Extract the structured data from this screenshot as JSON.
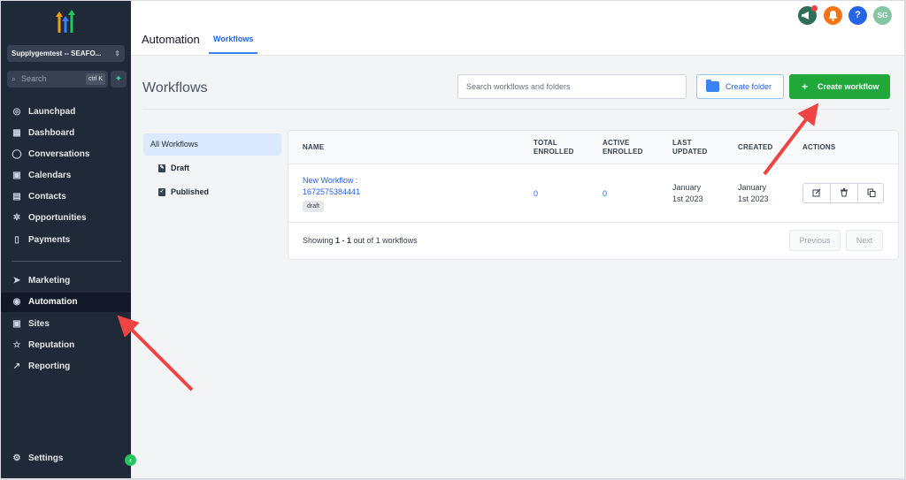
{
  "sidebar": {
    "account": "Supplygemtest -- SEAFO...",
    "search": {
      "placeholder": "Search",
      "shortcut": "ctrl K"
    },
    "items": [
      {
        "label": "Launchpad",
        "icon": "rocket-icon",
        "glyph": "◎"
      },
      {
        "label": "Dashboard",
        "icon": "grid-icon",
        "glyph": "▦"
      },
      {
        "label": "Conversations",
        "icon": "chat-icon",
        "glyph": "◯"
      },
      {
        "label": "Calendars",
        "icon": "calendar-icon",
        "glyph": "▣"
      },
      {
        "label": "Contacts",
        "icon": "contacts-icon",
        "glyph": "▤"
      },
      {
        "label": "Opportunities",
        "icon": "opportunities-icon",
        "glyph": "✲"
      },
      {
        "label": "Payments",
        "icon": "payments-icon",
        "glyph": "▯"
      },
      {
        "label": "Marketing",
        "icon": "send-icon",
        "glyph": "➤"
      },
      {
        "label": "Automation",
        "icon": "automation-icon",
        "glyph": "◉"
      },
      {
        "label": "Sites",
        "icon": "sites-icon",
        "glyph": "▣"
      },
      {
        "label": "Reputation",
        "icon": "star-icon",
        "glyph": "☆"
      },
      {
        "label": "Reporting",
        "icon": "trend-icon",
        "glyph": "↗"
      }
    ],
    "settings": "Settings"
  },
  "header": {
    "title": "Automation",
    "tab": "Workflows",
    "avatar": "SG",
    "help": "?"
  },
  "page": {
    "title": "Workflows",
    "search_placeholder": "Search workflows and folders",
    "create_folder": "Create folder",
    "create_workflow": "Create workflow"
  },
  "filters": {
    "all": "All Workflows",
    "draft": "Draft",
    "published": "Published"
  },
  "table": {
    "headers": {
      "name": "NAME",
      "total_1": "TOTAL",
      "total_2": "ENROLLED",
      "active_1": "ACTIVE",
      "active_2": "ENROLLED",
      "updated_1": "LAST",
      "updated_2": "UPDATED",
      "created": "CREATED",
      "actions": "ACTIONS"
    },
    "rows": [
      {
        "name_1": "New Workflow :",
        "name_2": "1672575384441",
        "status": "draft",
        "total_enrolled": "0",
        "active_enrolled": "0",
        "updated_1": "January",
        "updated_2": "1st 2023",
        "created_1": "January",
        "created_2": "1st 2023"
      }
    ],
    "footer": {
      "showing_prefix": "Showing ",
      "range": "1 - 1",
      "showing_suffix": " out of 1 workflows",
      "prev": "Previous",
      "next": "Next"
    }
  },
  "colors": {
    "sidebar": "#1f2937",
    "accent": "#2563eb",
    "green": "#22a83a",
    "annotation_arrow": "#ef4444"
  }
}
